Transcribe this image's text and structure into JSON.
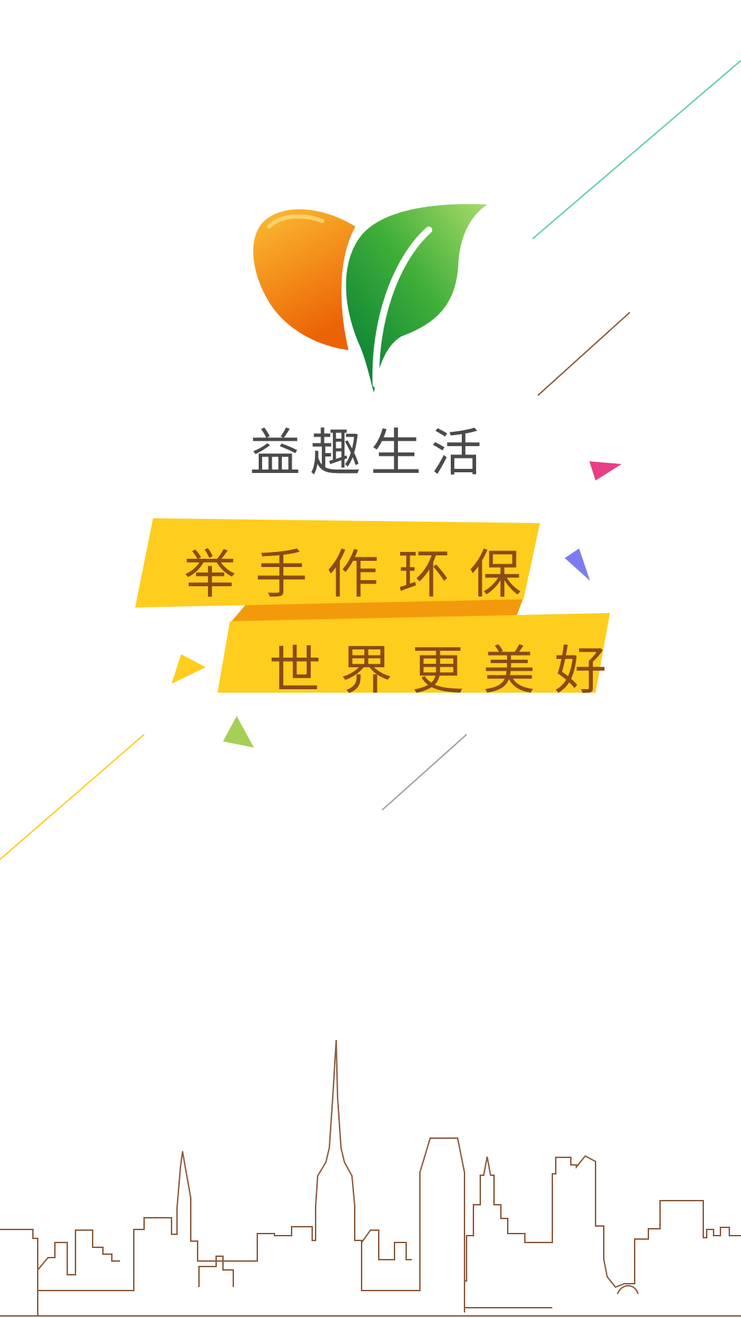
{
  "app": {
    "name": "益趣生活"
  },
  "logo": {
    "icon": "mango-leaf-logo-icon",
    "left_color": "#f28a18",
    "right_color": "#2ea23a"
  },
  "banner": {
    "line1": "举手作环保",
    "line2": "世界更美好",
    "ribbon_color": "#fecd1e",
    "fold_color": "#f39a0c",
    "text_color": "#8a4b12"
  },
  "decorations": {
    "icons": [
      "teal-line-icon",
      "brown-line-icon",
      "pink-triangle-icon",
      "blue-triangle-icon",
      "yellow-triangle-icon",
      "green-triangle-icon",
      "yellow-line-icon",
      "gray-line-icon"
    ],
    "skyline": "city-skyline-outline-icon",
    "skyline_color": "#8b5a3c"
  }
}
